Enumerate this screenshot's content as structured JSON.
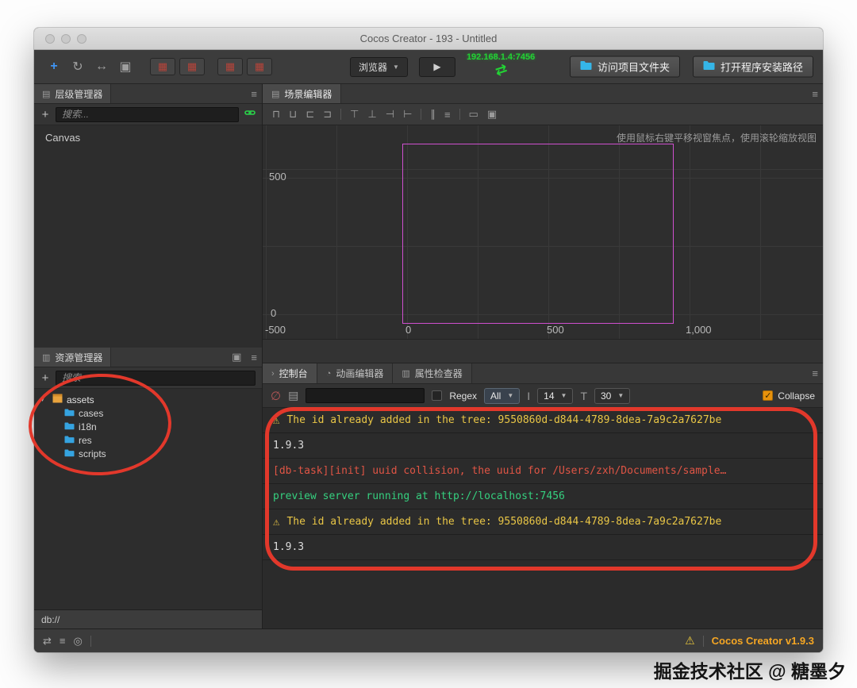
{
  "window": {
    "title": "Cocos Creator - 193 - Untitled"
  },
  "ui": {
    "menu_glyph": "≡",
    "add_glyph": "+",
    "dropdown_arrow": "▼",
    "check_glyph": "✓"
  },
  "toolbar": {
    "tools": [
      {
        "name": "move-tool",
        "glyph": "+"
      },
      {
        "name": "rotate-tool",
        "glyph": "↻"
      },
      {
        "name": "scale-tool",
        "glyph": "↔"
      },
      {
        "name": "rect-tool",
        "glyph": "▣"
      }
    ],
    "gizmo_buttons": [
      {
        "name": "gizmo-position-toggle",
        "glyph": "▦"
      },
      {
        "name": "gizmo-rotation-toggle",
        "glyph": "▦"
      },
      {
        "name": "gizmo-toggle-a",
        "glyph": "▦"
      },
      {
        "name": "gizmo-toggle-b",
        "glyph": "▦"
      }
    ],
    "browser_label": "浏览器",
    "play_glyph": "▶",
    "preview_url": "192.168.1.4:7456",
    "sync_glyph": "⇄",
    "open_project_button": "访问项目文件夹",
    "open_install_button": "打开程序安装路径"
  },
  "hierarchy": {
    "title": "层级管理器",
    "tab_icon": "▤",
    "search_placeholder": "搜索...",
    "nodes": [
      {
        "label": "Canvas"
      }
    ]
  },
  "assets": {
    "title": "资源管理器",
    "tab_icon": "▥",
    "search_placeholder": "搜索",
    "root": {
      "expander": "▾",
      "label": "assets"
    },
    "folders": [
      {
        "label": "cases"
      },
      {
        "label": "i18n"
      },
      {
        "label": "res"
      },
      {
        "label": "scripts"
      }
    ],
    "path_bar": "db://"
  },
  "scene": {
    "tab_label": "场景编辑器",
    "tab_icon": "▤",
    "hint": "使用鼠标右键平移视窗焦点，使用滚轮缩放视图",
    "toolbar_icons": [
      "⊓",
      "⊔",
      "⊏",
      "⊐",
      "⊤",
      "⊥",
      "⊣",
      "⊢",
      "∥",
      "≡",
      "▭",
      "▣"
    ],
    "y_labels": [
      "500",
      "0"
    ],
    "x_labels": [
      "-500",
      "0",
      "500",
      "1,000"
    ]
  },
  "console": {
    "tabs": [
      {
        "label": "控制台",
        "glyph": "›"
      },
      {
        "label": "动画编辑器",
        "glyph": "◔"
      },
      {
        "label": "属性检查器",
        "glyph": "▥"
      }
    ],
    "clear_glyph": "∅",
    "doc_glyph": "▤",
    "regex_label": "Regex",
    "filter_value": "All",
    "font_icon": "I",
    "font_size_value": "14",
    "lineheight_icon": "T",
    "line_height_value": "30",
    "collapse_label": "Collapse",
    "warn_glyph": "⚠",
    "logs": [
      {
        "type": "warn",
        "text": "The id already added in the tree: 9550860d-d844-4789-8dea-7a9c2a7627be"
      },
      {
        "type": "info",
        "text": "1.9.3"
      },
      {
        "type": "error",
        "text": "[db-task][init] uuid collision, the uuid for /Users/zxh/Documents/sample…"
      },
      {
        "type": "success",
        "text": "preview server running at http://localhost:7456"
      },
      {
        "type": "warn",
        "text": "The id already added in the tree: 9550860d-d844-4789-8dea-7a9c2a7627be"
      },
      {
        "type": "info",
        "text": "1.9.3"
      }
    ]
  },
  "statusbar": {
    "icons": [
      {
        "name": "sync-icon",
        "glyph": "⇄"
      },
      {
        "name": "database-icon",
        "glyph": "≡"
      },
      {
        "name": "eye-icon",
        "glyph": "◎"
      }
    ],
    "warning_glyph": "⚠",
    "version": "Cocos Creator v1.9.3"
  },
  "watermark": "掘金技术社区 @ 糖墨夕"
}
